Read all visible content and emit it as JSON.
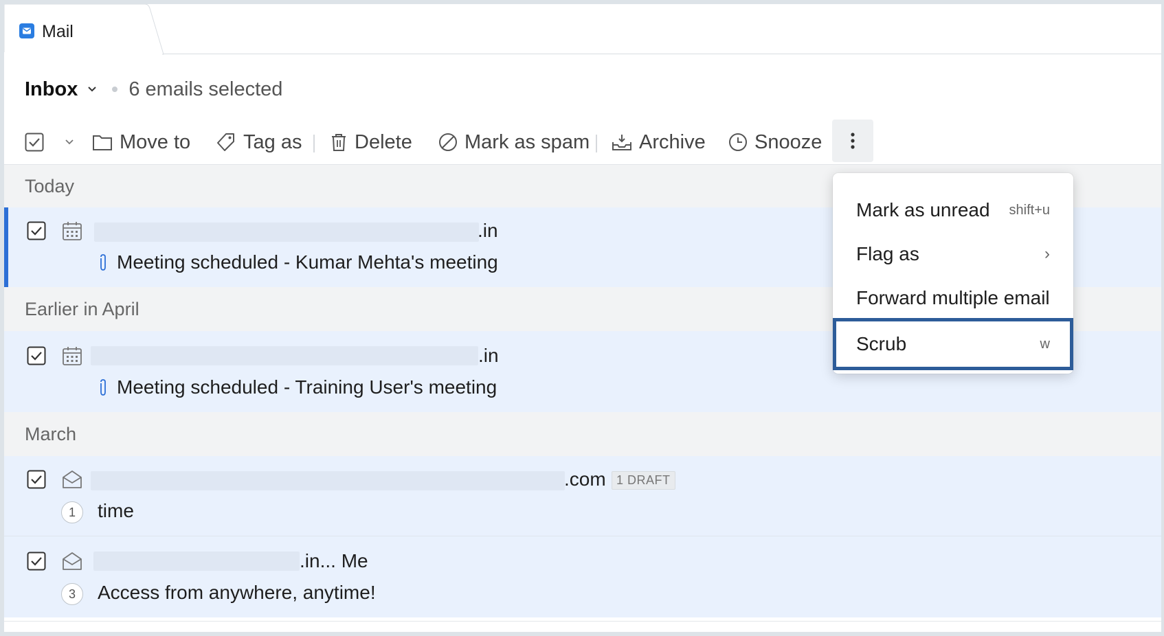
{
  "tab": {
    "title": "Mail"
  },
  "header": {
    "folder": "Inbox",
    "selected_text": "6 emails selected"
  },
  "toolbar": {
    "move_to": "Move to",
    "tag_as": "Tag as",
    "delete": "Delete",
    "mark_as_spam": "Mark as spam",
    "archive": "Archive",
    "snooze": "Snooze"
  },
  "groups": {
    "today": "Today",
    "earlier_april": "Earlier in April",
    "march": "March"
  },
  "emails": [
    {
      "sender_suffix": ".in",
      "subject": "Meeting scheduled - Kumar Mehta's meeting",
      "icon": "calendar-icon",
      "attachment": true
    },
    {
      "sender_suffix": ".in",
      "subject": "Meeting scheduled - Training User's meeting",
      "icon": "calendar-icon",
      "attachment": true
    },
    {
      "sender_suffix": ".com",
      "badge": "1 DRAFT",
      "count": "1",
      "subject": "time",
      "icon": "envelope-open-icon"
    },
    {
      "sender_suffix": ".in... Me",
      "count": "3",
      "subject": "Access from anywhere, anytime!",
      "icon": "envelope-open-icon"
    }
  ],
  "menu": {
    "items": [
      {
        "label": "Mark as unread",
        "shortcut": "shift+u"
      },
      {
        "label": "Flag as",
        "shortcut": "›"
      },
      {
        "label": "Forward multiple email",
        "shortcut": ""
      },
      {
        "label": "Scrub",
        "shortcut": "w"
      }
    ]
  },
  "colors": {
    "accent": "#2c6fd6",
    "row_selected": "#e9f1fd",
    "highlight_border": "#2d5c99"
  }
}
